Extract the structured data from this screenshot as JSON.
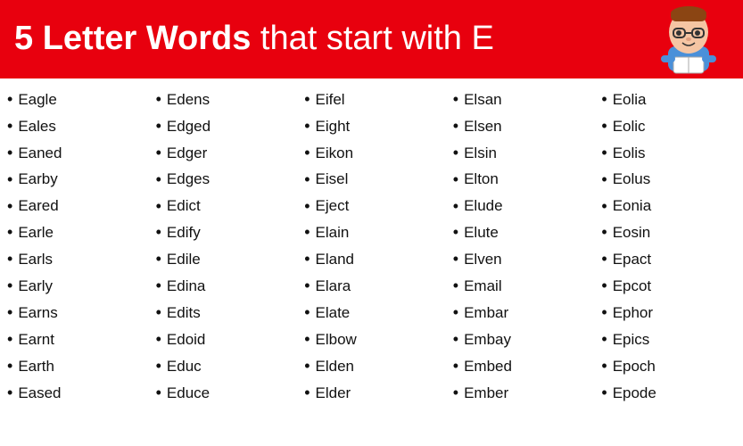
{
  "header": {
    "title_bold": "5 Letter Words",
    "title_normal": " that start with E"
  },
  "columns": [
    {
      "id": "col1",
      "words": [
        "Eagle",
        "Eales",
        "Eaned",
        "Earby",
        "Eared",
        "Earle",
        "Earls",
        "Early",
        "Earns",
        "Earnt",
        "Earth",
        "Eased"
      ]
    },
    {
      "id": "col2",
      "words": [
        "Edens",
        "Edged",
        "Edger",
        "Edges",
        "Edict",
        "Edify",
        "Edile",
        "Edina",
        "Edits",
        "Edoid",
        "Educ",
        "Educe"
      ]
    },
    {
      "id": "col3",
      "words": [
        "Eifel",
        "Eight",
        "Eikon",
        "Eisel",
        "Eject",
        "Elain",
        "Eland",
        "Elara",
        "Elate",
        "Elbow",
        "Elden",
        "Elder"
      ]
    },
    {
      "id": "col4",
      "words": [
        "Elsan",
        "Elsen",
        "Elsin",
        "Elton",
        "Elude",
        "Elute",
        "Elven",
        "Email",
        "Embar",
        "Embay",
        "Embed",
        "Ember"
      ]
    },
    {
      "id": "col5",
      "words": [
        "Eolia",
        "Eolic",
        "Eolis",
        "Eolus",
        "Eonia",
        "Eosin",
        "Epact",
        "Epcot",
        "Ephor",
        "Epics",
        "Epoch",
        "Epode"
      ]
    }
  ]
}
